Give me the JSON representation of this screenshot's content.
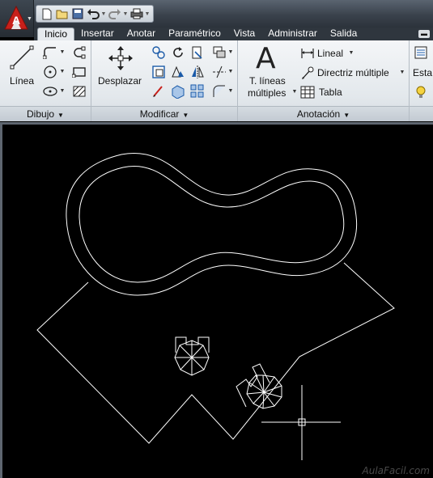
{
  "app": {
    "logo_letter": "A"
  },
  "quick_access": {
    "items": [
      "new-icon",
      "open-icon",
      "save-icon",
      "undo-icon",
      "redo-icon",
      "plot-icon"
    ]
  },
  "tabs": [
    "Inicio",
    "Insertar",
    "Anotar",
    "Paramétrico",
    "Vista",
    "Administrar",
    "Salida"
  ],
  "active_tab": "Inicio",
  "ribbon": {
    "dibujo": {
      "line_label": "Línea",
      "footer": "Dibujo"
    },
    "modificar": {
      "move_label": "Desplazar",
      "footer": "Modificar"
    },
    "anotacion": {
      "mtext_glyph": "A",
      "mtext_line1": "T. líneas",
      "mtext_line2": "múltiples",
      "linear_label": "Lineal",
      "mleader_label": "Directriz múltiple",
      "table_label": "Tabla",
      "footer": "Anotación"
    },
    "capas": {
      "partial_label": "Esta"
    }
  },
  "watermark": "AulaFacil.com",
  "colors": {
    "accent_red": "#c8201a",
    "canvas_bg": "#000000",
    "stroke": "#ffffff"
  }
}
